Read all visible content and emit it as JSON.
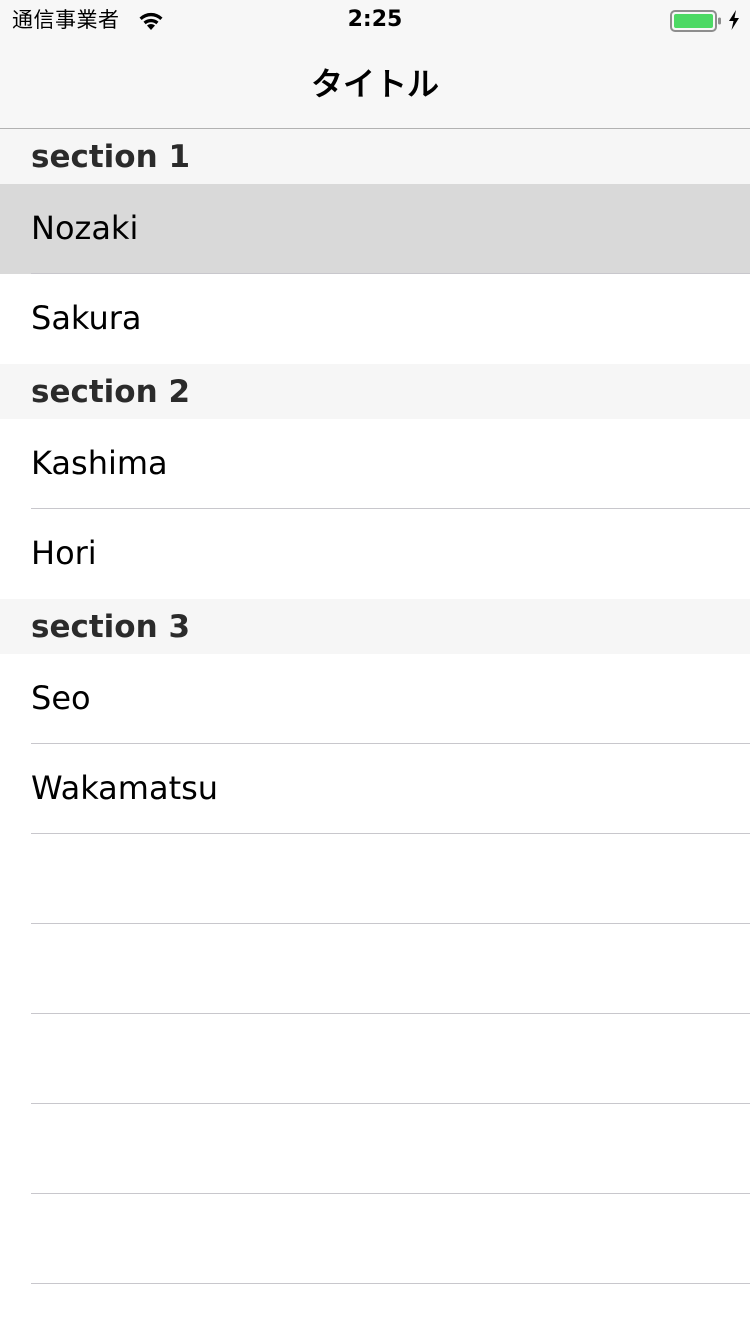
{
  "status_bar": {
    "carrier": "通信事業者",
    "time": "2:25",
    "battery_color": "#4cd964",
    "icons": [
      "wifi-icon",
      "battery-icon",
      "charging-bolt-icon"
    ]
  },
  "nav": {
    "title": "タイトル"
  },
  "sections": [
    {
      "header": "section 1",
      "rows": [
        "Nozaki",
        "Sakura"
      ],
      "selected_row": "Nozaki"
    },
    {
      "header": "section 2",
      "rows": [
        "Kashima",
        "Hori"
      ]
    },
    {
      "header": "section 3",
      "rows": [
        "Seo",
        "Wakamatsu"
      ]
    }
  ],
  "colors": {
    "selected_row": "#d9d9d9",
    "section_header_bg": "#f6f6f6",
    "separator": "#c8c7cc"
  }
}
